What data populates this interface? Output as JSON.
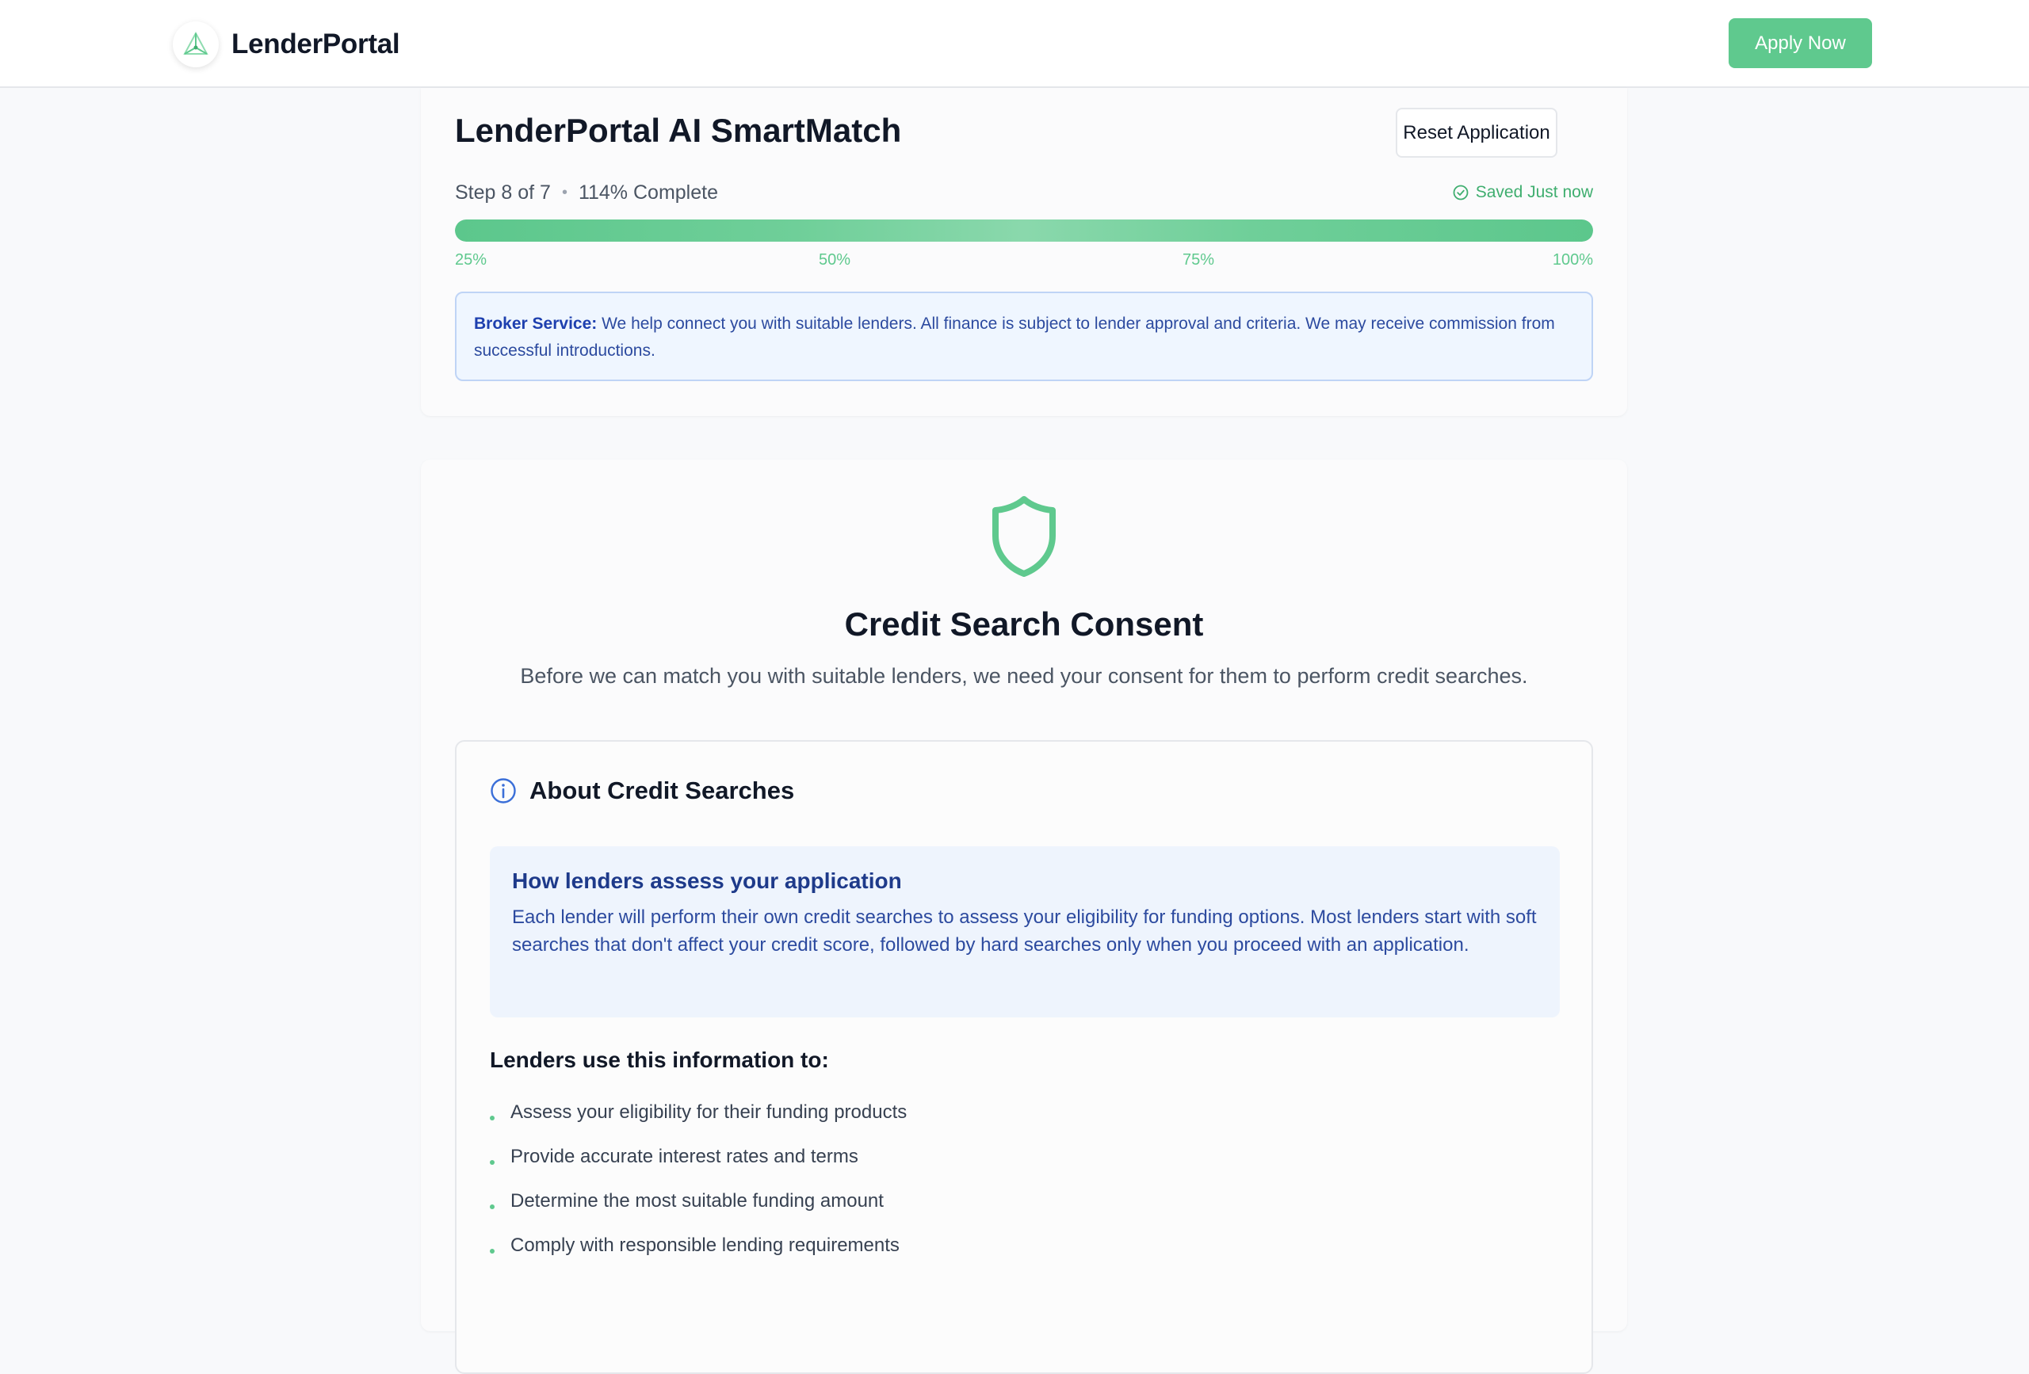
{
  "header": {
    "brand_name": "LenderPortal",
    "logo_icon": "triangle-network-icon",
    "apply_label": "Apply Now",
    "accent_color": "#5fc98e"
  },
  "progress_card": {
    "title": "LenderPortal AI SmartMatch",
    "reset_label": "Reset Application",
    "step_text": "Step 8 of 7",
    "separator": "•",
    "percent_text": "114% Complete",
    "saved_text": "Saved Just now",
    "progress_fraction": 1.0,
    "ticks": [
      "25%",
      "50%",
      "75%",
      "100%"
    ],
    "broker_label": "Broker Service:",
    "broker_text": "We help connect you with suitable lenders. All finance is subject to lender approval and criteria. We may receive commission from successful introductions."
  },
  "consent": {
    "icon": "shield-icon",
    "title": "Credit Search Consent",
    "subtitle": "Before we can match you with suitable lenders, we need your consent for them to perform credit searches.",
    "about": {
      "icon": "info-icon",
      "title": "About Credit Searches",
      "how_title": "How lenders assess your application",
      "how_text": "Each lender will perform their own credit searches to assess your eligibility for funding options. Most lenders start with soft searches that don't affect your credit score, followed by hard searches only when you proceed with an application.",
      "uses_title": "Lenders use this information to:",
      "uses": [
        "Assess your eligibility for their funding products",
        "Provide accurate interest rates and terms",
        "Determine the most suitable funding amount",
        "Comply with responsible lending requirements"
      ]
    }
  }
}
